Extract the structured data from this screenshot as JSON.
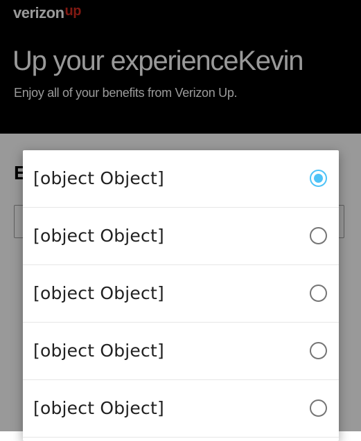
{
  "header": {
    "logo_main": "verizon",
    "logo_accent": "up",
    "title": "Up your experienceKevin",
    "subtitle": "Enjoy all of your benefits from Verizon Up."
  },
  "content": {
    "section_heading": "E"
  },
  "dialog": {
    "options": [
      {
        "label": "[object Object]",
        "selected": true
      },
      {
        "label": "[object Object]",
        "selected": false
      },
      {
        "label": "[object Object]",
        "selected": false
      },
      {
        "label": "[object Object]",
        "selected": false
      },
      {
        "label": "[object Object]",
        "selected": false
      }
    ]
  },
  "colors": {
    "hero_background": "#000000",
    "brand_red": "#d52b1e",
    "radio_selected": "#4fc3f7",
    "radio_unselected": "#757575"
  }
}
